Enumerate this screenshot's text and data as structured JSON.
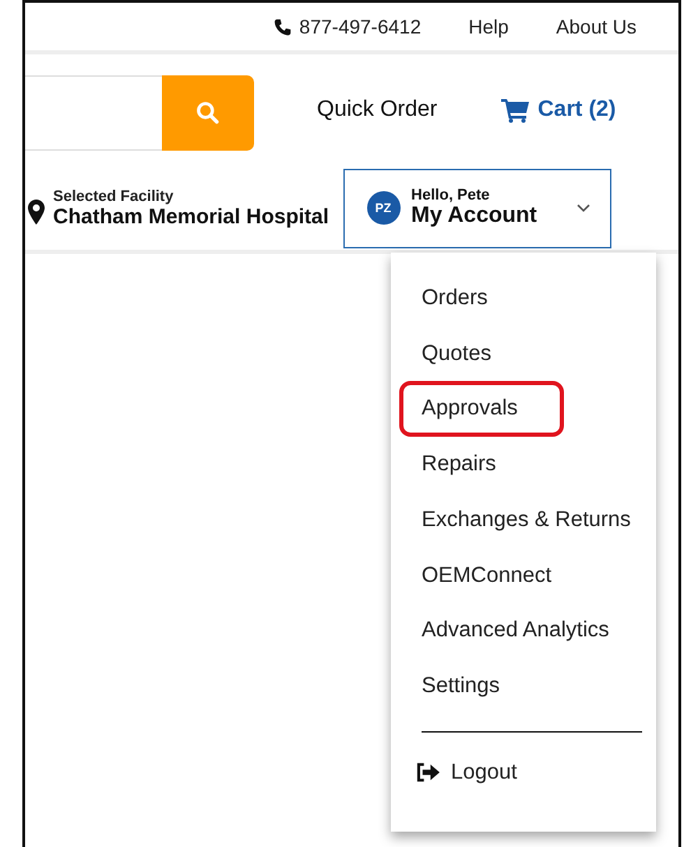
{
  "top_bar": {
    "phone": "877-497-6412",
    "links": [
      "Help",
      "About Us"
    ]
  },
  "header": {
    "quick_order": "Quick Order",
    "cart": "Cart (2)"
  },
  "facility": {
    "label": "Selected Facility",
    "name": "Chatham Memorial Hospital"
  },
  "account": {
    "initials": "PZ",
    "greeting": "Hello, Pete",
    "label": "My Account",
    "expanded": true
  },
  "menu": {
    "items": [
      {
        "label": "Orders",
        "highlighted": false
      },
      {
        "label": "Quotes",
        "highlighted": false
      },
      {
        "label": "Approvals",
        "highlighted": true
      },
      {
        "label": "Repairs",
        "highlighted": false
      },
      {
        "label": "Exchanges & Returns",
        "highlighted": false
      },
      {
        "label": "OEMConnect",
        "highlighted": false
      },
      {
        "label": "Advanced Analytics",
        "highlighted": false
      },
      {
        "label": "Settings",
        "highlighted": false
      }
    ],
    "logout": "Logout"
  }
}
